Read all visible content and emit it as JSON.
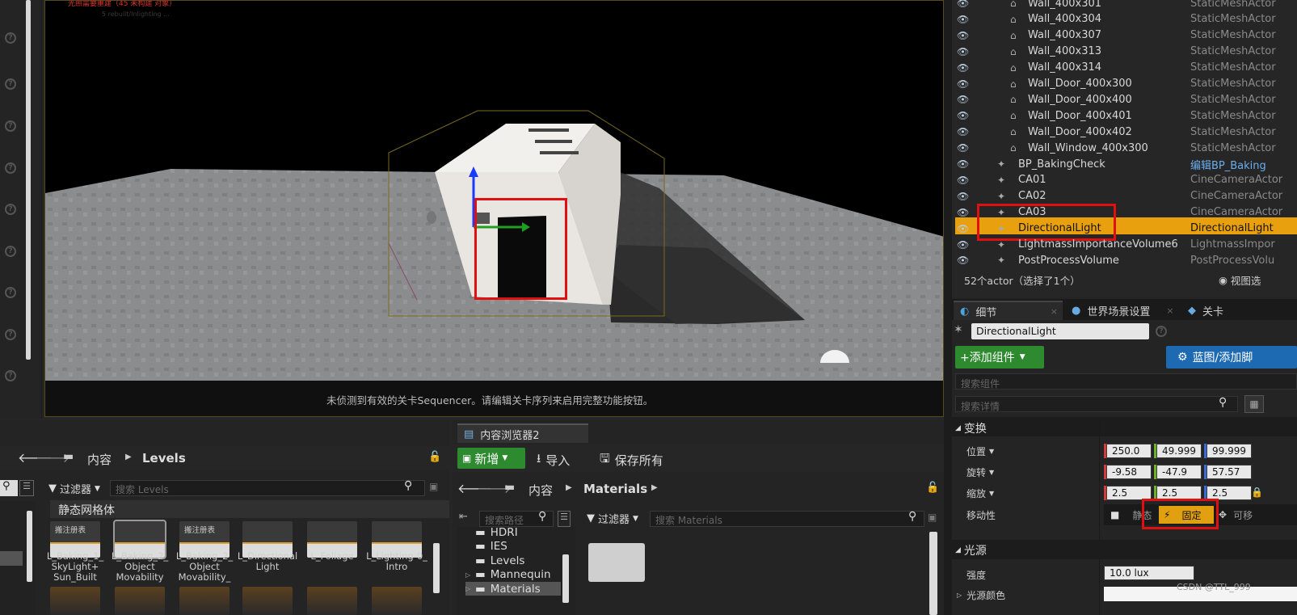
{
  "viewport": {
    "top_red_text": "光照需要重建（45 未构建 对象）",
    "faint_text": "5 rebuilt/Inlighting ...",
    "sequencer_msg": "未侦测到有效的关卡Sequencer。请编辑关卡序列来启用完整功能按钮。"
  },
  "outliner": {
    "rows": [
      {
        "name": "Wall_400x301",
        "type": "StaticMeshActor"
      },
      {
        "name": "Wall_400x304",
        "type": "StaticMeshActor"
      },
      {
        "name": "Wall_400x307",
        "type": "StaticMeshActor"
      },
      {
        "name": "Wall_400x313",
        "type": "StaticMeshActor"
      },
      {
        "name": "Wall_400x314",
        "type": "StaticMeshActor"
      },
      {
        "name": "Wall_Door_400x300",
        "type": "StaticMeshActor"
      },
      {
        "name": "Wall_Door_400x400",
        "type": "StaticMeshActor"
      },
      {
        "name": "Wall_Door_400x401",
        "type": "StaticMeshActor"
      },
      {
        "name": "Wall_Door_400x402",
        "type": "StaticMeshActor"
      },
      {
        "name": "Wall_Window_400x300",
        "type": "StaticMeshActor"
      },
      {
        "name": "BP_BakingCheck",
        "type": "编辑BP_Baking"
      },
      {
        "name": "CA01",
        "type": "CineCameraActor"
      },
      {
        "name": "CA02",
        "type": "CineCameraActor"
      },
      {
        "name": "CA03",
        "type": "CineCameraActor"
      },
      {
        "name": "DirectionalLight",
        "type": "DirectionalLight"
      },
      {
        "name": "LightmassImportanceVolume6",
        "type": "LightmassImpor"
      },
      {
        "name": "PostProcessVolume",
        "type": "PostProcessVolu"
      }
    ],
    "count": "52个actor（选择了1个）",
    "view_options": "视图选"
  },
  "details": {
    "tabs": [
      "细节",
      "世界场景设置",
      "关卡"
    ],
    "name_value": "DirectionalLight",
    "add_component": "+添加组件",
    "blueprint": "蓝图/添加脚",
    "search_components": "搜索组件",
    "search_details": "搜索详情",
    "transform_header": "变换",
    "location": "位置",
    "rotation": "旋转",
    "scale": "缩放",
    "mobility": "移动性",
    "loc": [
      "250.0",
      "49.999",
      "99.999"
    ],
    "rot": [
      "-9.58",
      "-47.9",
      "57.57"
    ],
    "scl": [
      "2.5",
      "2.5",
      "2.5"
    ],
    "mob": [
      "静态",
      "固定",
      "可移"
    ],
    "light_header": "光源",
    "intensity": "强度",
    "intensity_value": "10.0 lux",
    "light_color": "光源颜色"
  },
  "cb1": {
    "path": [
      "内容",
      "Levels"
    ],
    "filter": "过滤器",
    "search": "搜索 Levels",
    "category": "静态网格体",
    "items": [
      {
        "label": "L_Baking_1_ SkyLight+ Sun_Built",
        "tag": "搬注册表"
      },
      {
        "label": "L_Baking_2_ Object Movability",
        "tag": ""
      },
      {
        "label": "L_Baking_2_ Object Movability_",
        "tag": "搬注册表"
      },
      {
        "label": "L_Directional Light",
        "tag": ""
      },
      {
        "label": "L_Foliage",
        "tag": ""
      },
      {
        "label": "L_Lighting-0_ Intro",
        "tag": ""
      }
    ]
  },
  "cb2": {
    "tab": "内容浏览器2",
    "new": "新增",
    "import": "导入",
    "save_all": "保存所有",
    "path": [
      "内容",
      "Materials"
    ],
    "search_paths": "搜索路径",
    "filter": "过滤器",
    "search": "搜索 Materials",
    "tree": [
      "HDRI",
      "IES",
      "Levels",
      "Mannequin",
      "Materials"
    ]
  },
  "watermark": "CSDN @TTL_999"
}
